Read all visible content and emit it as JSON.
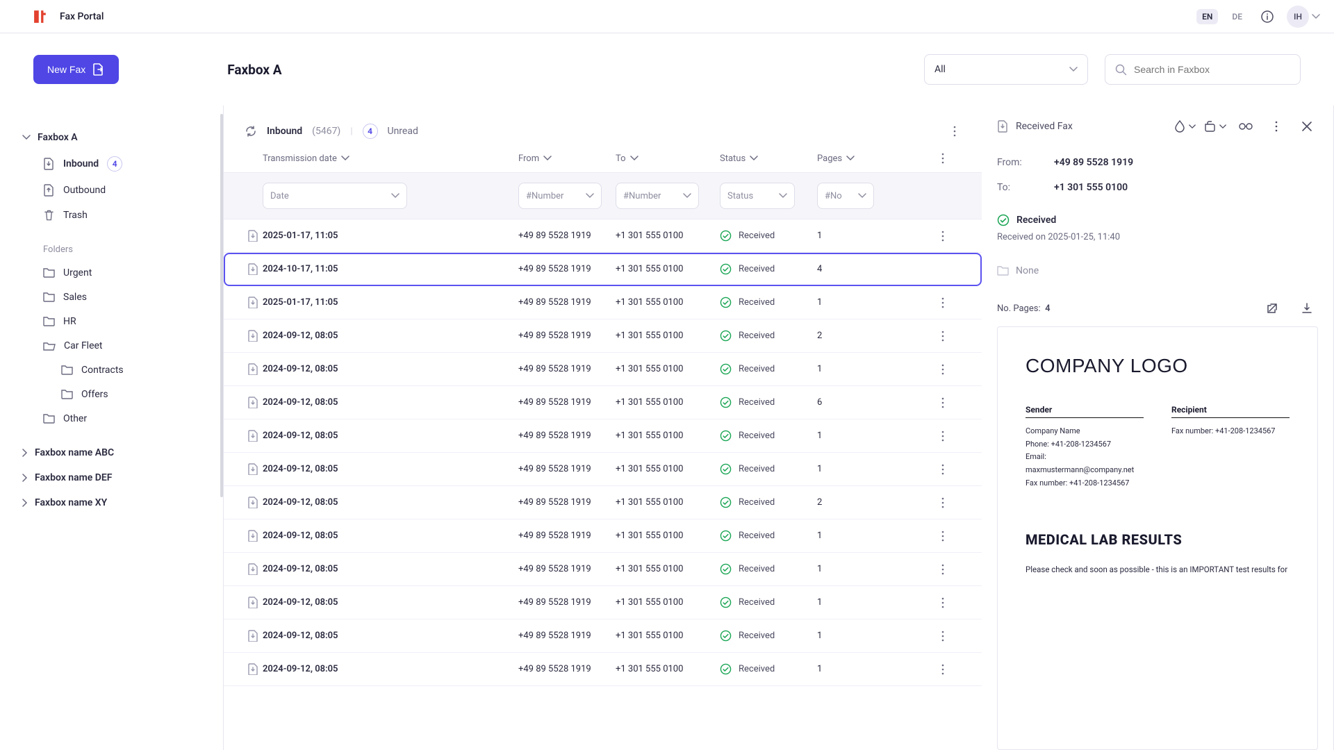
{
  "app": {
    "title": "Fax Portal"
  },
  "topbar": {
    "lang_en": "EN",
    "lang_de": "DE",
    "avatar_initials": "IH"
  },
  "subheader": {
    "new_fax_label": "New Fax",
    "page_title": "Faxbox A",
    "filter_value": "All",
    "search_placeholder": "Search in Faxbox"
  },
  "sidebar": {
    "faxbox_a": "Faxbox A",
    "inbound": "Inbound",
    "inbound_badge": "4",
    "outbound": "Outbound",
    "trash": "Trash",
    "folders_label": "Folders",
    "urgent": "Urgent",
    "sales": "Sales",
    "hr": "HR",
    "car_fleet": "Car Fleet",
    "contracts": "Contracts",
    "offers": "Offers",
    "other": "Other",
    "faxbox_abc": "Faxbox name ABC",
    "faxbox_def": "Faxbox name DEF",
    "faxbox_xy": "Faxbox name XY"
  },
  "list": {
    "meta_label": "Inbound",
    "meta_count": "(5467)",
    "meta_badge": "4",
    "meta_unread": "Unread",
    "headers": {
      "date": "Transmission date",
      "from": "From",
      "to": "To",
      "status": "Status",
      "pages": "Pages"
    },
    "filters": {
      "date": "Date",
      "from": "#Number",
      "to": "#Number",
      "status": "Status",
      "pages": "#No"
    },
    "rows": [
      {
        "date": "2025-01-17, 11:05",
        "from": "+49 89 5528 1919",
        "to": "+1 301 555 0100",
        "status": "Received",
        "pages": "1",
        "selected": false
      },
      {
        "date": "2024-10-17, 11:05",
        "from": "+49 89 5528 1919",
        "to": "+1 301 555 0100",
        "status": "Received",
        "pages": "4",
        "selected": true
      },
      {
        "date": "2025-01-17, 11:05",
        "from": "+49 89 5528 1919",
        "to": "+1 301 555 0100",
        "status": "Received",
        "pages": "1",
        "selected": false
      },
      {
        "date": "2024-09-12, 08:05",
        "from": "+49 89 5528 1919",
        "to": "+1 301 555 0100",
        "status": "Received",
        "pages": "2",
        "selected": false
      },
      {
        "date": "2024-09-12, 08:05",
        "from": "+49 89 5528 1919",
        "to": "+1 301 555 0100",
        "status": "Received",
        "pages": "1",
        "selected": false
      },
      {
        "date": "2024-09-12, 08:05",
        "from": "+49 89 5528 1919",
        "to": "+1 301 555 0100",
        "status": "Received",
        "pages": "6",
        "selected": false
      },
      {
        "date": "2024-09-12, 08:05",
        "from": "+49 89 5528 1919",
        "to": "+1 301 555 0100",
        "status": "Received",
        "pages": "1",
        "selected": false
      },
      {
        "date": "2024-09-12, 08:05",
        "from": "+49 89 5528 1919",
        "to": "+1 301 555 0100",
        "status": "Received",
        "pages": "1",
        "selected": false
      },
      {
        "date": "2024-09-12, 08:05",
        "from": "+49 89 5528 1919",
        "to": "+1 301 555 0100",
        "status": "Received",
        "pages": "2",
        "selected": false
      },
      {
        "date": "2024-09-12, 08:05",
        "from": "+49 89 5528 1919",
        "to": "+1 301 555 0100",
        "status": "Received",
        "pages": "1",
        "selected": false
      },
      {
        "date": "2024-09-12, 08:05",
        "from": "+49 89 5528 1919",
        "to": "+1 301 555 0100",
        "status": "Received",
        "pages": "1",
        "selected": false
      },
      {
        "date": "2024-09-12, 08:05",
        "from": "+49 89 5528 1919",
        "to": "+1 301 555 0100",
        "status": "Received",
        "pages": "1",
        "selected": false
      },
      {
        "date": "2024-09-12, 08:05",
        "from": "+49 89 5528 1919",
        "to": "+1 301 555 0100",
        "status": "Received",
        "pages": "1",
        "selected": false
      },
      {
        "date": "2024-09-12, 08:05",
        "from": "+49 89 5528 1919",
        "to": "+1 301 555 0100",
        "status": "Received",
        "pages": "1",
        "selected": false
      }
    ]
  },
  "detail": {
    "title": "Received Fax",
    "from_label": "From:",
    "from_value": "+49 89 5528 1919",
    "to_label": "To:",
    "to_value": "+1 301 555 0100",
    "status": "Received",
    "received_on": "Received on 2025-01-25, 11:40",
    "folder_none": "None",
    "pages_label": "No. Pages:",
    "pages_value": "4",
    "preview": {
      "logo": "COMPANY LOGO",
      "sender_h": "Sender",
      "recipient_h": "Recipient",
      "company": "Company Name",
      "phone": "Phone: +41-208-1234567",
      "email": "Email: maxmustermann@company.net",
      "sender_fax": "Fax number: +41-208-1234567",
      "recipient_fax": "Fax number: +41-208-1234567",
      "heading": "MEDICAL LAB RESULTS",
      "body": "Please check and  soon as possible - this is an IMPORTANT test results for"
    }
  }
}
